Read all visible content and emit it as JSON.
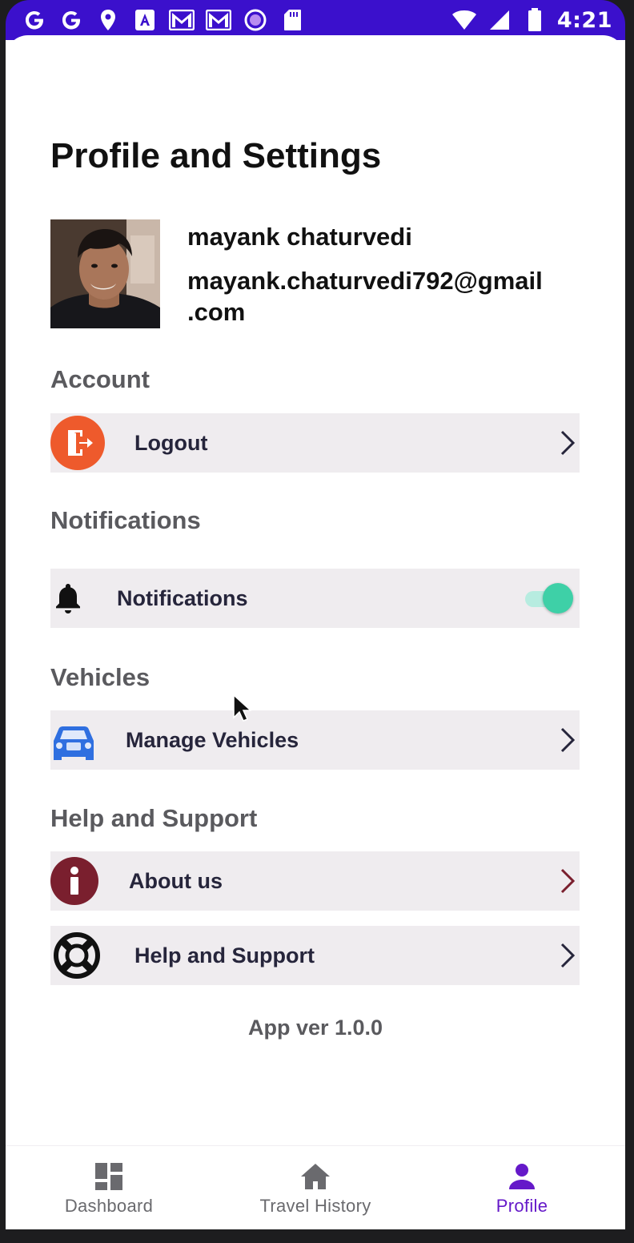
{
  "status_bar": {
    "left_icons": [
      "google-g-icon",
      "google-g-icon",
      "location-pin-icon",
      "font-a-icon",
      "gmail-icon",
      "gmail-icon",
      "record-circle-icon",
      "sd-card-icon"
    ],
    "right_icons": [
      "wifi-icon",
      "cell-signal-icon",
      "battery-icon"
    ],
    "time": "4:21",
    "background_color": "#3b10cc"
  },
  "page": {
    "title": "Profile and Settings"
  },
  "profile": {
    "name": "mayank chaturvedi",
    "email_line1": "mayank.chaturvedi792@gmail",
    "email_line2": ".com"
  },
  "sections": {
    "account": {
      "title": "Account",
      "logout": {
        "label": "Logout",
        "icon": "logout-door-icon",
        "icon_color": "#ee5a2c"
      }
    },
    "notifications": {
      "title": "Notifications",
      "notifications": {
        "label": "Notifications",
        "icon": "bell-icon",
        "toggle_on": true,
        "toggle_color": "#3ed0a7"
      }
    },
    "vehicles": {
      "title": "Vehicles",
      "manage": {
        "label": "Manage Vehicles",
        "icon": "car-icon",
        "icon_color": "#2f6fe0"
      }
    },
    "help": {
      "title": "Help and Support",
      "about": {
        "label": "About us",
        "icon": "info-icon",
        "icon_color": "#7a1f2e"
      },
      "support": {
        "label": "Help and Support",
        "icon": "lifebuoy-icon"
      }
    }
  },
  "app_version": "App ver 1.0.0",
  "bottom_nav": {
    "items": [
      {
        "label": "Dashboard",
        "icon": "dashboard-icon",
        "active": false
      },
      {
        "label": "Travel History",
        "icon": "home-icon",
        "active": false
      },
      {
        "label": "Profile",
        "icon": "person-icon",
        "active": true
      }
    ],
    "active_color": "#6519c9"
  }
}
